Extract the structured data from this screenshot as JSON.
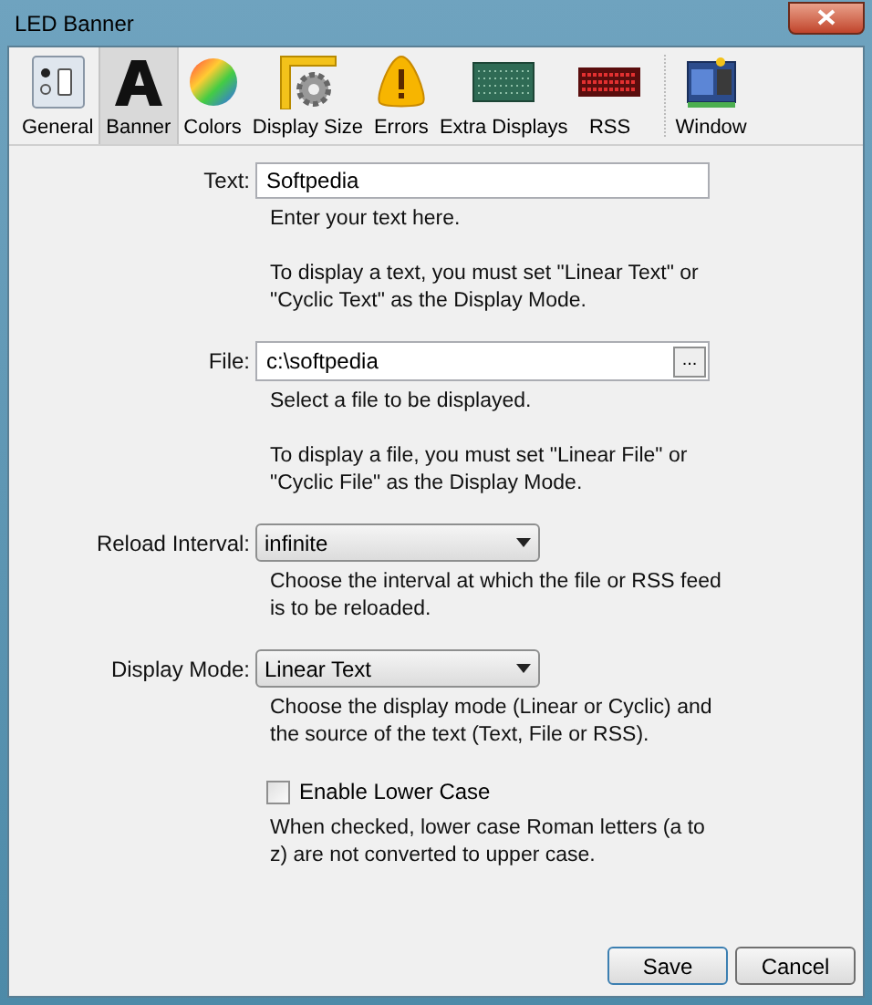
{
  "window": {
    "title": "LED Banner"
  },
  "tabs": [
    {
      "label": "General",
      "selected": false
    },
    {
      "label": "Banner",
      "selected": true
    },
    {
      "label": "Colors",
      "selected": false
    },
    {
      "label": "Display Size",
      "selected": false
    },
    {
      "label": "Errors",
      "selected": false
    },
    {
      "label": "Extra Displays",
      "selected": false
    },
    {
      "label": "RSS",
      "selected": false
    },
    {
      "label": "Window",
      "selected": false
    }
  ],
  "fields": [
    {
      "kind": "text",
      "label": "Text:",
      "value": "Softpedia",
      "help": [
        "Enter your text here.",
        "To display a text, you must set \"Linear Text\" or \"Cyclic Text\" as the Display Mode."
      ]
    },
    {
      "kind": "file",
      "label": "File:",
      "value": "c:\\softpedia",
      "browse": "...",
      "help": [
        "Select a file to be displayed.",
        "To display a file, you must set \"Linear File\" or \"Cyclic File\" as the Display Mode."
      ]
    },
    {
      "kind": "select",
      "label": "Reload Interval:",
      "value": "infinite",
      "help": [
        "Choose the interval at which the file or RSS feed is to be reloaded."
      ]
    },
    {
      "kind": "select",
      "label": "Display Mode:",
      "value": "Linear Text",
      "help": [
        "Choose the display mode (Linear or Cyclic) and the source of the text (Text, File or RSS)."
      ]
    },
    {
      "kind": "checkbox",
      "label": "Enable Lower Case",
      "checked": false,
      "help": [
        "When checked, lower case Roman letters (a to z) are not converted to upper case."
      ]
    }
  ],
  "buttons": [
    "Save",
    "Cancel"
  ]
}
